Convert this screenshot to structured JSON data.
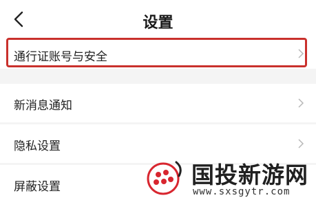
{
  "header": {
    "title": "设置",
    "back_icon": "chevron-left-icon"
  },
  "settings": {
    "items": [
      {
        "label": "通行证账号与安全",
        "highlighted": true
      },
      {
        "label": "新消息通知"
      },
      {
        "label": "隐私设置"
      },
      {
        "label": "屏蔽设置"
      }
    ],
    "chevron_icon": "chevron-right-icon"
  },
  "watermark": {
    "name": "国投新游网",
    "url": "www.sxsgytr.com"
  },
  "colors": {
    "highlight": "#c9302c",
    "background": "#f4f4f4"
  }
}
